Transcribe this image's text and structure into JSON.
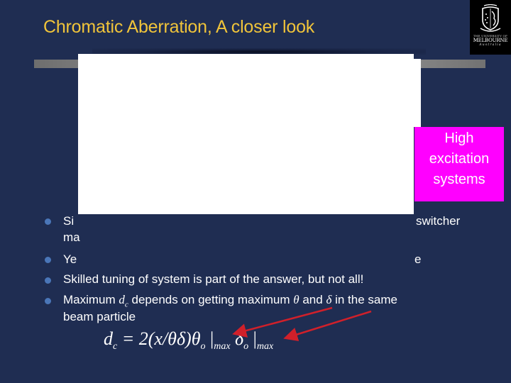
{
  "slide": {
    "title": "Chromatic Aberration, A closer look",
    "logo": {
      "line1": "THE UNIVERSITY OF",
      "line2": "MELBOURNE",
      "line3": "Australia"
    },
    "callout": {
      "lines": [
        "High",
        "excitation",
        "systems"
      ],
      "background": "#ff00ff"
    },
    "bullets": [
      {
        "visible_start": "Si",
        "visible_end": "switcher",
        "line2_start": "ma"
      },
      {
        "visible_start": "Ye",
        "visible_end": "e"
      },
      {
        "text": "Skilled tuning of system is part of the answer, but not all!"
      },
      {
        "text_before": "Maximum ",
        "math_var": "d",
        "math_sub": "c",
        "text_mid": " depends on getting maximum ",
        "theta": "θ",
        "and": " and ",
        "delta": "δ",
        "text_after": " in the same",
        "line2": "beam particle"
      }
    ],
    "formula": {
      "lhs": "d",
      "lhs_sub": "c",
      "rhs_part1": " = 2(x/θδ)θ",
      "sub_o1": "o",
      "bar1": " |",
      "max1": "max",
      "delta": " δ",
      "sub_o2": "o",
      "bar2": " |",
      "max2": "max"
    },
    "colors": {
      "background": "#1f2d52",
      "title": "#f0c43a",
      "bullet": "#4a76b8",
      "arrow": "#d0202a"
    }
  }
}
